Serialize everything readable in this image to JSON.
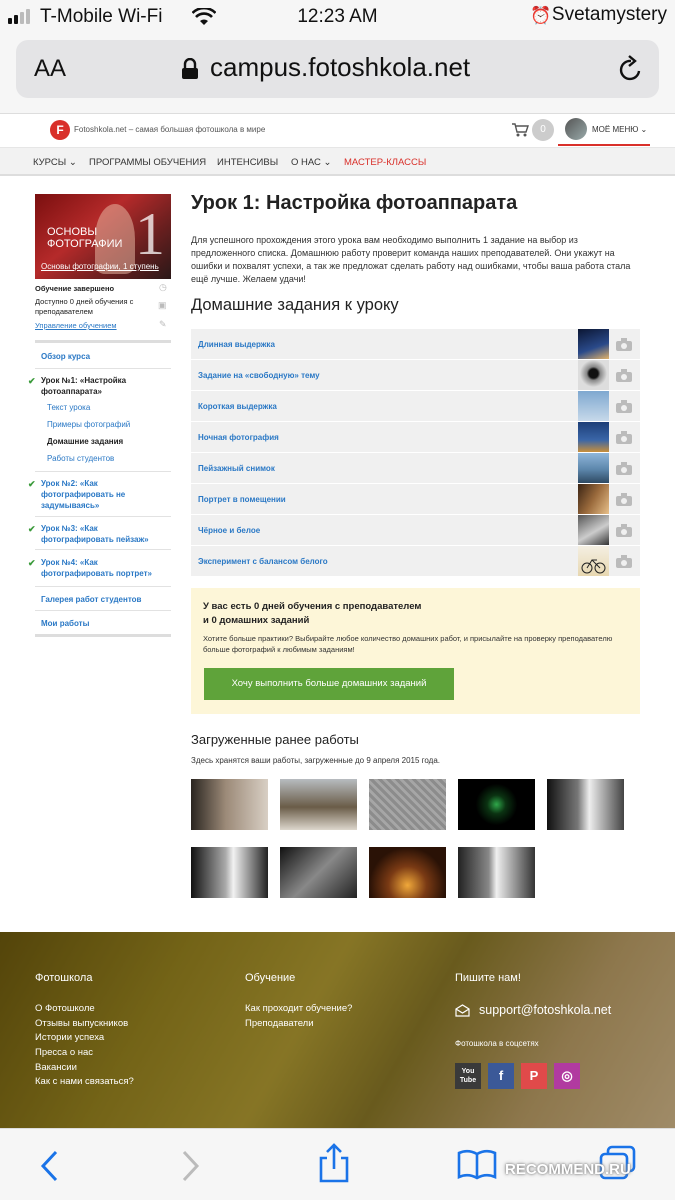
{
  "status_bar": {
    "carrier": "T-Mobile Wi-Fi",
    "time": "12:23 AM",
    "user": "Svetamystery"
  },
  "browser": {
    "text_size_button": "AA",
    "url": "campus.fotoshkola.net"
  },
  "site_header": {
    "logo_letter": "F",
    "tagline": "Fotoshkola.net – самая большая фотошкола в мире",
    "cart_count": "0",
    "my_menu": "МОЁ МЕНЮ ⌄"
  },
  "nav": {
    "items": [
      "КУРСЫ ⌄",
      "ПРОГРАММЫ ОБУЧЕНИЯ",
      "ИНТЕНСИВЫ",
      "О НАС ⌄",
      "МАСТЕР-КЛАССЫ"
    ]
  },
  "sidebar": {
    "course_title_line1": "ОСНОВЫ",
    "course_title_line2": "ФОТОГРАФИИ",
    "course_number": "1",
    "course_caption": "Основы фотографии, 1 ступень",
    "status": "Обучение завершено",
    "days_available": "Доступно 0 дней обучения с преподавателем",
    "manage_link": "Управление обучением",
    "overview": "Обзор курса",
    "lesson1": "Урок №1: «Настройка фотоаппарата»",
    "sub_items": [
      "Текст урока",
      "Примеры фотографий",
      "Домашние задания",
      "Работы студентов"
    ],
    "lesson2": "Урок №2: «Как фотографировать не задумываясь»",
    "lesson3": "Урок №3: «Как фотографировать пейзаж»",
    "lesson4": "Урок №4: «Как фотографировать портрет»",
    "gallery": "Галерея работ студентов",
    "my_works": "Мои работы"
  },
  "main": {
    "title": "Урок 1: Настройка фотоаппарата",
    "intro": "Для успешного прохождения этого урока вам необходимо выполнить 1 задание на выбор из предложенного списка. Домашнюю работу проверит команда наших преподавателей. Они укажут на ошибки и похвалят успехи, а так же предложат сделать работу над ошибками, чтобы ваша работа стала ещё лучше. Желаем удачи!",
    "homework_heading": "Домашние задания к уроку",
    "homework": [
      "Длинная выдержка",
      "Задание на «свободную» тему",
      "Короткая выдержка",
      "Ночная фотография",
      "Пейзажный снимок",
      "Портрет в помещении",
      "Чёрное и белое",
      "Эксперимент с балансом белого"
    ],
    "promo_heading_line1": "У вас есть 0 дней обучения с преподавателем",
    "promo_heading_line2": "и 0 домашних заданий",
    "promo_text": "Хотите больше практики? Выбирайте любое количество домашних работ, и присылайте на проверку преподавателю больше фотографий к любимым заданиям!",
    "promo_button": "Хочу выполнить больше домашних заданий",
    "uploaded_heading": "Загруженные ранее работы",
    "uploaded_text": "Здесь хранятся ваши работы, загруженные до 9 апреля 2015 года."
  },
  "footer": {
    "col1_title": "Фотошкола",
    "col1_links": [
      "О Фотошколе",
      "Отзывы выпускников",
      "Истории успеха",
      "Пресса о нас",
      "Вакансии",
      "Как с нами связаться?"
    ],
    "col2_title": "Обучение",
    "col2_links": [
      "Как проходит обучение?",
      "Преподаватели"
    ],
    "col3_title": "Пишите нам!",
    "email": "support@fotoshkola.net",
    "social_title": "Фотошкола в соцсетях",
    "social": [
      "You Tube",
      "f",
      "P",
      "◎"
    ]
  },
  "watermark": "RECOMMEND.RU",
  "colors": {
    "accent_red": "#d9302a",
    "link_blue": "#2a78c5",
    "button_green": "#5fa33a",
    "promo_bg": "#fdf6d8"
  }
}
